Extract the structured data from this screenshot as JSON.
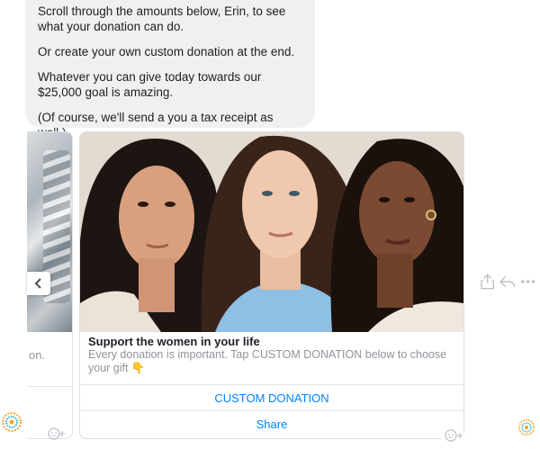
{
  "message": {
    "lines": [
      "Scroll through the amounts below, Erin, to see what your donation can do.",
      "Or create your own custom donation at the end.",
      "Whatever you can give today towards our $25,000 goal is amazing.",
      "(Of course, we'll send a you a tax receipt as well.)"
    ]
  },
  "prev_card": {
    "subtitle_fragment": "on."
  },
  "card": {
    "title": "Support the women in your life",
    "subtitle": "Every donation is important. Tap CUSTOM DONATION below to choose your gift 👇",
    "buttons": {
      "custom": "CUSTOM DONATION",
      "share": "Share"
    }
  },
  "icons": {
    "carousel_prev": "chevron-left-icon",
    "share": "share-icon",
    "reply": "reply-icon",
    "more": "more-icon",
    "react": "emoji-react-icon",
    "avatar": "page-avatar-icon"
  },
  "colors": {
    "bubble_bg": "#f1f0f0",
    "link_blue": "#0084ff",
    "muted": "#90949c",
    "avatar_orange": "#f5a623",
    "avatar_teal": "#2bb3c0"
  }
}
